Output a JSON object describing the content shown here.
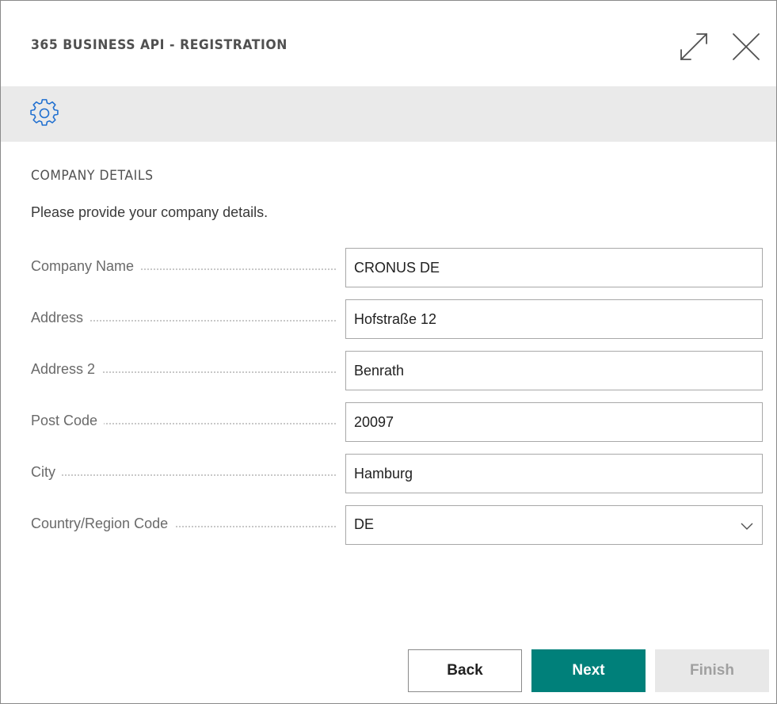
{
  "dialog": {
    "title": "365 BUSINESS API - REGISTRATION",
    "expand_icon": "expand-icon",
    "close_icon": "close-icon"
  },
  "actionbar": {
    "settings_icon": "gear-icon"
  },
  "section": {
    "title": "COMPANY DETAILS",
    "instructions": "Please provide your company details."
  },
  "fields": [
    {
      "label": "Company Name",
      "value": "CRONUS DE"
    },
    {
      "label": "Address",
      "value": "Hofstraße 12"
    },
    {
      "label": "Address 2",
      "value": "Benrath"
    },
    {
      "label": "Post Code",
      "value": "20097"
    },
    {
      "label": "City",
      "value": "Hamburg"
    },
    {
      "label": "Country/Region Code",
      "value": "DE"
    }
  ],
  "buttons": {
    "back": "Back",
    "next": "Next",
    "finish": "Finish"
  },
  "colors": {
    "primary": "#00807a",
    "actionbar_bg": "#eaeaea",
    "disabled_bg": "#e8e8e8"
  }
}
